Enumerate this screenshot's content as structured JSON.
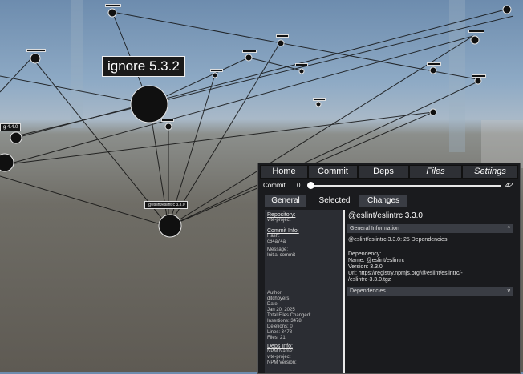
{
  "scene": {
    "big_label": "ignore 5.3.2",
    "side_label": "g 4.4.0",
    "focus_label": "@eslint/eslintrc 3.3.0",
    "tiny_labels": [
      "",
      "",
      "",
      "",
      "",
      "",
      "",
      "",
      "",
      "",
      ""
    ]
  },
  "nav": {
    "home": "Home",
    "commit": "Commit",
    "deps": "Deps",
    "files": "Files",
    "settings": "Settings"
  },
  "commit_slider": {
    "label": "Commit:",
    "min": "0",
    "max": "42",
    "value_fraction": 0.0
  },
  "subtabs": {
    "general": "General",
    "selected": "Selected",
    "changes": "Changes"
  },
  "left": {
    "repo_heading": "Repository:",
    "repo_name": "vite-project",
    "commit_heading": "Commit Info:",
    "hash_label": "Hash:",
    "hash": "c64a74a",
    "message_label": "Message:",
    "message": "Initial commit",
    "author_label": "Author:",
    "author": "ditchbyers",
    "date_label": "Date:",
    "date": "Jan 20, 2025",
    "total_files_label": "Total Files Changed:",
    "insertions": "Insertions: 3478",
    "deletions": "Deletions: 0",
    "lines": "Lines: 3478",
    "files": "Files: 21",
    "deps_heading": "Deps Info:",
    "npm_name_label": "NPM Name:",
    "npm_name": "vite-project",
    "npm_version_label": "NPM Version:"
  },
  "detail": {
    "title": "@eslint/eslintrc 3.3.0",
    "general_info_header": "General Information",
    "summary": "@eslint/eslintrc 3.3.0: 25 Dependencies",
    "dependency_label": "Dependency:",
    "name_line": "Name: @eslint/eslintrc",
    "version_line": "Version: 3.3.0",
    "url_line1": "Url: https://registry.npmjs.org/@eslint/eslintrc/-",
    "url_line2": "/eslintrc-3.3.0.tgz",
    "dependencies_header": "Dependencies",
    "chev_up": "^",
    "chev_down": "v"
  }
}
